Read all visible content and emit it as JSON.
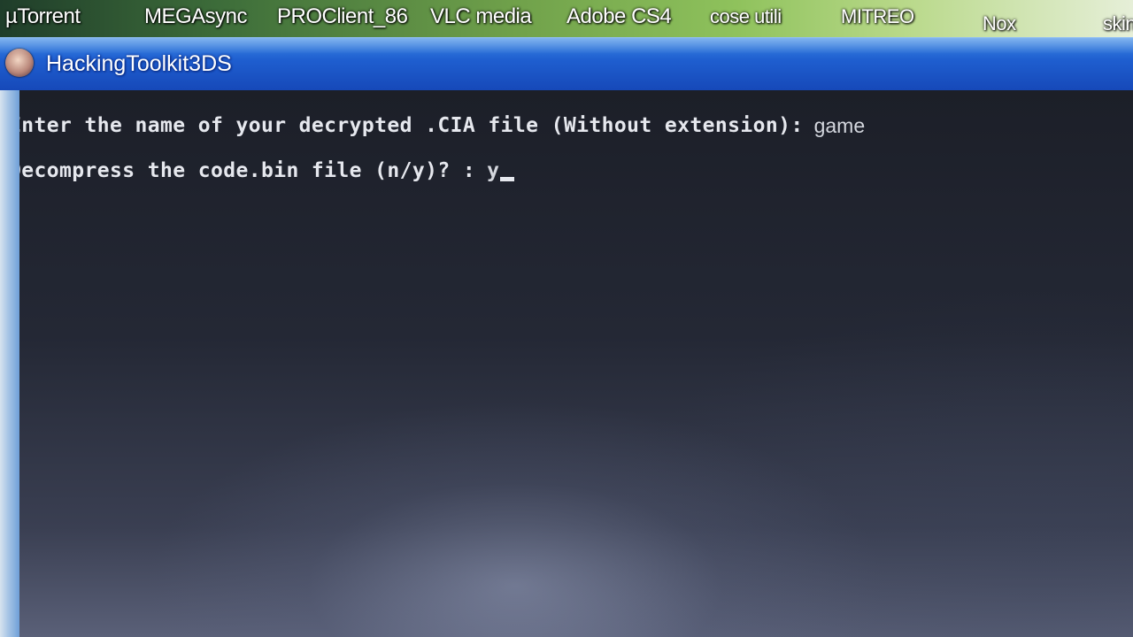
{
  "desktop": {
    "shortcuts": [
      "µTorrent",
      "MEGAsync",
      "PROClient_86",
      "VLC media",
      "Adobe CS4",
      "cose utili",
      "MITREO",
      "Nox",
      "skin"
    ]
  },
  "window": {
    "title": "HackingToolkit3DS",
    "icon": "app-avatar-icon"
  },
  "console": {
    "lines": [
      {
        "prompt": "Enter the name of your decrypted .CIA file (Without extension):",
        "input": "game"
      },
      {
        "prompt": "Decompress the code.bin file (n/y)? :",
        "input": "y"
      }
    ]
  },
  "colors": {
    "title_bar": "#1f5fd0",
    "console_background": "#1c1f28",
    "console_text": "#e6e8ee"
  }
}
